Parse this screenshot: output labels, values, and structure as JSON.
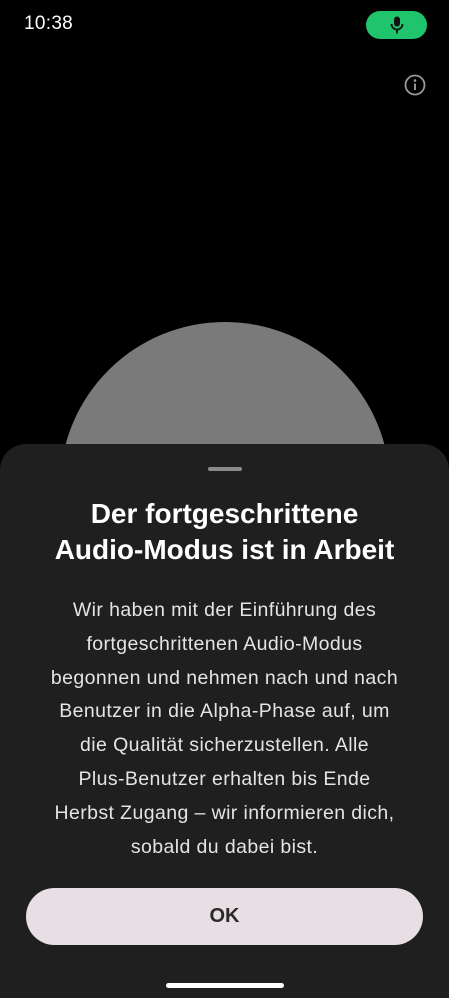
{
  "status_bar": {
    "time": "10:38",
    "mic_icon": "microphone-icon",
    "mic_pill_color": "#1fc46c"
  },
  "top_actions": {
    "info_icon": "info-icon"
  },
  "sheet": {
    "title": "Der fortgeschrittene\nAudio-Modus ist in Arbeit",
    "body": "Wir haben mit der Einführung des\nfortgeschrittenen Audio-Modus\nbegonnen und nehmen nach und nach\nBenutzer in die Alpha-Phase auf, um\ndie Qualität sicherzustellen. Alle\nPlus-Benutzer erhalten bis Ende\nHerbst Zugang – wir informieren dich,\nsobald du dabei bist.",
    "ok_label": "OK",
    "ok_button_color": "#e8dfe4"
  },
  "colors": {
    "background": "#000000",
    "sheet": "#1f1f1f",
    "orb": "#7a7a7a"
  }
}
